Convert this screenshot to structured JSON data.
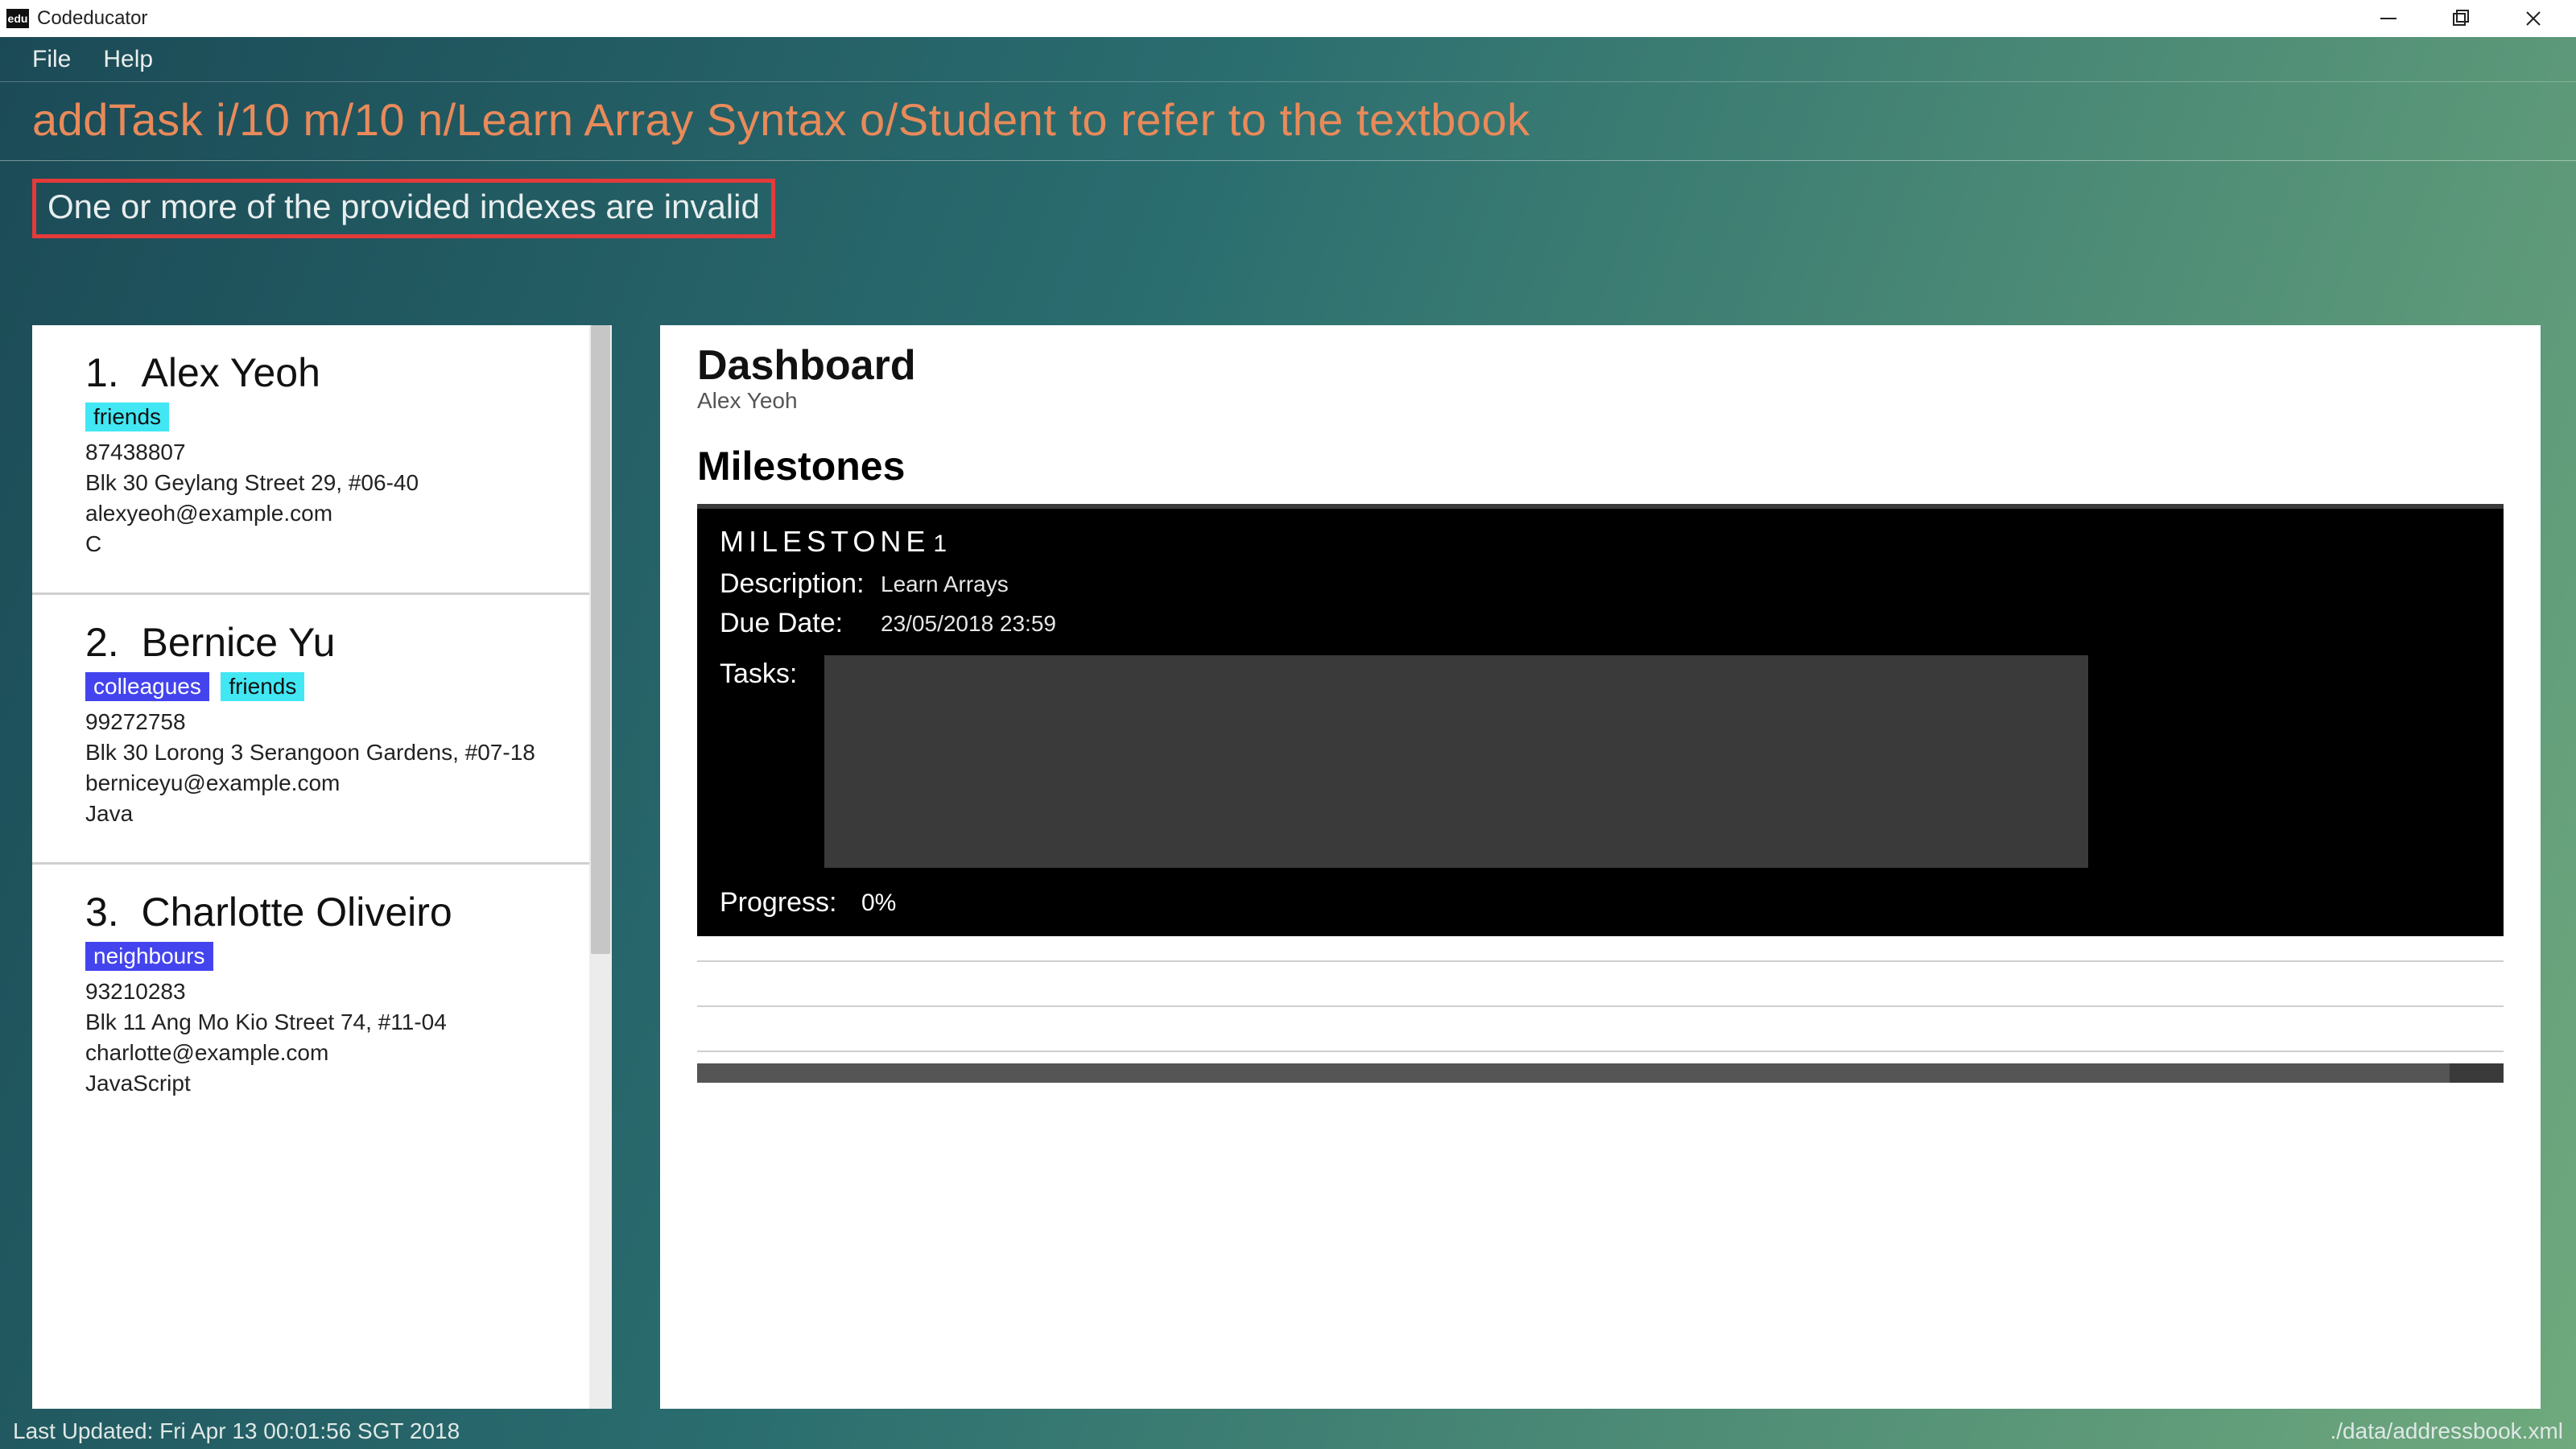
{
  "titlebar": {
    "app_name": "Codeducator",
    "icon_text": "edu"
  },
  "menu": {
    "file": "File",
    "help": "Help"
  },
  "command": {
    "value": "addTask i/10 m/10 n/Learn Array Syntax o/Student to refer to the textbook"
  },
  "error": {
    "message": "One or more of the provided indexes are invalid"
  },
  "people": [
    {
      "index": "1.",
      "name": "Alex Yeoh",
      "tags": [
        {
          "text": "friends",
          "cls": "friends"
        }
      ],
      "phone": "87438807",
      "address": "Blk 30 Geylang Street 29, #06-40",
      "email": "alexyeoh@example.com",
      "lang": "C"
    },
    {
      "index": "2.",
      "name": "Bernice Yu",
      "tags": [
        {
          "text": "colleagues",
          "cls": "colleagues"
        },
        {
          "text": "friends",
          "cls": "friends"
        }
      ],
      "phone": "99272758",
      "address": "Blk 30 Lorong 3 Serangoon Gardens, #07-18",
      "email": "berniceyu@example.com",
      "lang": "Java"
    },
    {
      "index": "3.",
      "name": "Charlotte Oliveiro",
      "tags": [
        {
          "text": "neighbours",
          "cls": "neighbours"
        }
      ],
      "phone": "93210283",
      "address": "Blk 11 Ang Mo Kio Street 74, #11-04",
      "email": "charlotte@example.com",
      "lang": "JavaScript"
    }
  ],
  "dashboard": {
    "title": "Dashboard",
    "subtitle": "Alex Yeoh",
    "milestones_header": "Milestones",
    "milestone": {
      "label": "MILESTONE",
      "number": "1",
      "description_label": "Description:",
      "description_value": "Learn Arrays",
      "due_label": "Due Date:",
      "due_value": "23/05/2018 23:59",
      "tasks_label": "Tasks:",
      "progress_label": "Progress:",
      "progress_value": "0%"
    }
  },
  "statusbar": {
    "left": "Last Updated: Fri Apr 13 00:01:56 SGT 2018",
    "right": "./data/addressbook.xml"
  }
}
